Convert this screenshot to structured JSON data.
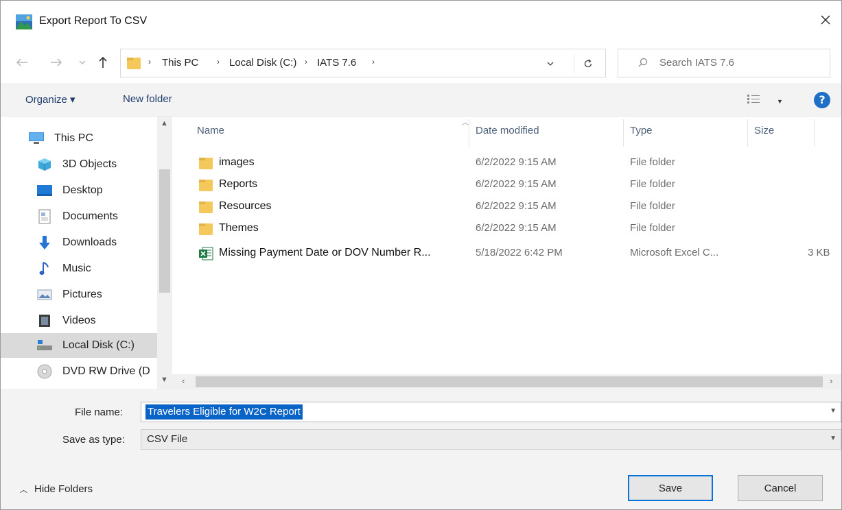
{
  "window": {
    "title": "Export Report To CSV",
    "close_icon": "close-icon"
  },
  "address": {
    "crumbs": [
      "This PC",
      "Local Disk (C:)",
      "IATS 7.6"
    ],
    "search_placeholder": "Search IATS 7.6"
  },
  "toolbar": {
    "organize_label": "Organize ▾",
    "new_folder_label": "New folder",
    "help_label": "?"
  },
  "nav": {
    "items": [
      {
        "label": "This PC",
        "icon": "computer-icon"
      },
      {
        "label": "3D Objects",
        "icon": "cube-icon"
      },
      {
        "label": "Desktop",
        "icon": "desktop-icon"
      },
      {
        "label": "Documents",
        "icon": "document-icon"
      },
      {
        "label": "Downloads",
        "icon": "download-arrow-icon"
      },
      {
        "label": "Music",
        "icon": "music-note-icon"
      },
      {
        "label": "Pictures",
        "icon": "picture-icon"
      },
      {
        "label": "Videos",
        "icon": "film-icon"
      },
      {
        "label": "Local Disk (C:)",
        "icon": "drive-icon"
      },
      {
        "label": "DVD RW Drive (D",
        "icon": "disc-icon"
      }
    ],
    "selected_index": 8
  },
  "files": {
    "columns": {
      "name": "Name",
      "date": "Date modified",
      "type": "Type",
      "size": "Size"
    },
    "rows": [
      {
        "name": "images",
        "date": "6/2/2022 9:15 AM",
        "type": "File folder",
        "size": "",
        "icon": "folder-icon"
      },
      {
        "name": "Reports",
        "date": "6/2/2022 9:15 AM",
        "type": "File folder",
        "size": "",
        "icon": "folder-icon"
      },
      {
        "name": "Resources",
        "date": "6/2/2022 9:15 AM",
        "type": "File folder",
        "size": "",
        "icon": "folder-icon"
      },
      {
        "name": "Themes",
        "date": "6/2/2022 9:15 AM",
        "type": "File folder",
        "size": "",
        "icon": "folder-icon"
      },
      {
        "name": "Missing Payment Date or DOV Number R...",
        "date": "5/18/2022 6:42 PM",
        "type": "Microsoft Excel C...",
        "size": "3 KB",
        "icon": "excel-file-icon"
      }
    ]
  },
  "form": {
    "file_name_label": "File name:",
    "file_name_value": "Travelers Eligible for W2C Report",
    "save_type_label": "Save as type:",
    "save_type_value": "CSV File"
  },
  "footer": {
    "hide_folders_label": "Hide Folders",
    "save_label": "Save",
    "cancel_label": "Cancel"
  },
  "colors": {
    "accent": "#0b73d8",
    "selection": "#0a64c8",
    "folder": "#f4c85a",
    "excel": "#1d7a44"
  }
}
